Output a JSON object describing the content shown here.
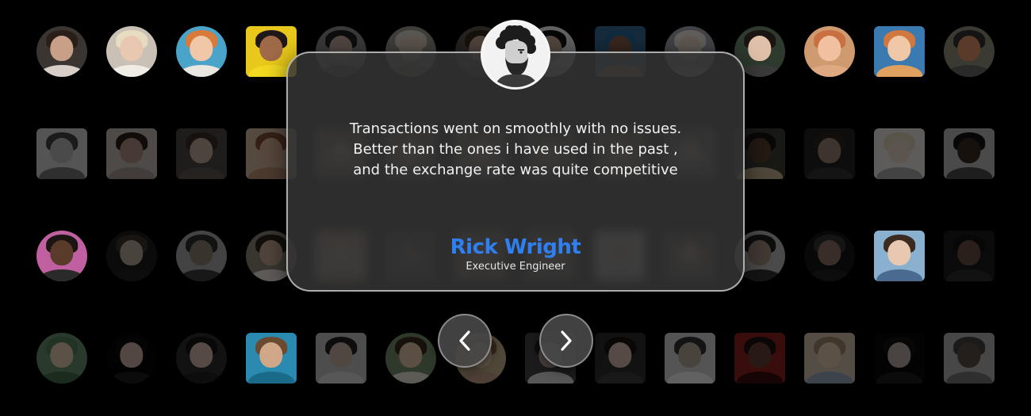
{
  "testimonial": {
    "quote_lines": [
      "Transactions went on smoothly with no issues.",
      "Better than the ones i have used in the past ,",
      "and the exchange rate was quite competitive"
    ],
    "name": "Rick Wright",
    "role": "Executive Engineer"
  },
  "nav": {
    "prev_icon": "chevron-left-icon",
    "next_icon": "chevron-right-icon"
  },
  "colors": {
    "accent": "#2f7ff0",
    "card_bg": "#343434",
    "background": "#000000"
  },
  "avatars": [
    {
      "shape": "circle",
      "bg": "#3a3530",
      "skin": "#c8a088",
      "hair": "#2a1f18",
      "cloth": "#d8d0c8",
      "tone": "normal"
    },
    {
      "shape": "circle",
      "bg": "#c9c1b5",
      "skin": "#e8c8b0",
      "hair": "#e8dcc0",
      "cloth": "#f0ece6",
      "tone": "normal"
    },
    {
      "shape": "circle",
      "bg": "#4aa3c8",
      "skin": "#f0c8a8",
      "hair": "#d87a3a",
      "cloth": "#eae6e0",
      "tone": "normal"
    },
    {
      "shape": "square",
      "bg": "#e8c81a",
      "skin": "#a06a48",
      "hair": "#201818",
      "cloth": "#f2d820",
      "tone": "normal"
    },
    {
      "shape": "circle",
      "bg": "#8a8a8a",
      "skin": "#c8a898",
      "hair": "#202020",
      "cloth": "#505050",
      "tone": "dim"
    },
    {
      "shape": "circle",
      "bg": "#9a9488",
      "skin": "#e0c8b0",
      "hair": "#d8d0c0",
      "cloth": "#807a70",
      "tone": "dim"
    },
    {
      "shape": "circle",
      "bg": "#5a5048",
      "skin": "#c8a088",
      "hair": "#3a2818",
      "cloth": "#404040",
      "tone": "dim"
    },
    {
      "shape": "circle",
      "bg": "#e8e8e8",
      "skin": "#c8a890",
      "hair": "#101010",
      "cloth": "#d0d0d0",
      "tone": "dim"
    },
    {
      "shape": "square",
      "bg": "#2a6a9a",
      "skin": "#8a5a40",
      "hair": "#1a6aa0",
      "cloth": "#b08040",
      "tone": "dim"
    },
    {
      "shape": "circle",
      "bg": "#9aa0a8",
      "skin": "#e8d0c0",
      "hair": "#e8e0d8",
      "cloth": "#c0c4c8",
      "tone": "dim"
    },
    {
      "shape": "circle",
      "bg": "#2e3a2e",
      "skin": "#e0c0a8",
      "hair": "#1a1412",
      "cloth": "#3a3a3a",
      "tone": "normal"
    },
    {
      "shape": "circle",
      "bg": "#d09a70",
      "skin": "#f0c0a0",
      "hair": "#c87040",
      "cloth": "#e0a880",
      "tone": "normal"
    },
    {
      "shape": "square",
      "bg": "#3a7ab0",
      "skin": "#f0c8a8",
      "hair": "#d07840",
      "cloth": "#e0a060",
      "tone": "normal"
    },
    {
      "shape": "circle",
      "bg": "#3a3a32",
      "skin": "#5a3a28",
      "hair": "#141414",
      "cloth": "#2a2a2a",
      "tone": "normal"
    },
    {
      "shape": "square",
      "bg": "#c8c8c8",
      "skin": "#b0b0b0",
      "hair": "#404040",
      "cloth": "#707070",
      "tone": "dim"
    },
    {
      "shape": "square",
      "bg": "#b8b0a8",
      "skin": "#b08878",
      "hair": "#2a1a14",
      "cloth": "#a0908a",
      "tone": "dim"
    },
    {
      "shape": "square",
      "bg": "#4a4440",
      "skin": "#c0a090",
      "hair": "#3a2a20",
      "cloth": "#5a5048",
      "tone": "dim"
    },
    {
      "shape": "square",
      "bg": "#d0b090",
      "skin": "#d8a888",
      "hair": "#8a4a28",
      "cloth": "#c08868",
      "tone": "dim"
    },
    {
      "shape": "square",
      "bg": "#8a7a6a",
      "skin": "#c8a088",
      "hair": "#3a2a20",
      "cloth": "#6a5a4a",
      "tone": "blurred"
    },
    {
      "shape": "square",
      "bg": "#7a7066",
      "skin": "#d0b098",
      "hair": "#4a3828",
      "cloth": "#5a5048",
      "tone": "blurred"
    },
    {
      "shape": "square",
      "bg": "#8a8076",
      "skin": "#c8a890",
      "hair": "#3a2a20",
      "cloth": "#6a6056",
      "tone": "blurred"
    },
    {
      "shape": "square",
      "bg": "#6a6058",
      "skin": "#b89880",
      "hair": "#2a1e18",
      "cloth": "#5a5048",
      "tone": "blurred"
    },
    {
      "shape": "square",
      "bg": "#7a7066",
      "skin": "#c8a088",
      "hair": "#3a2a20",
      "cloth": "#6a5a4a",
      "tone": "blurred"
    },
    {
      "shape": "square",
      "bg": "#6a6a6a",
      "skin": "#c0a898",
      "hair": "#2a2a2a",
      "cloth": "#505050",
      "tone": "blurred"
    },
    {
      "shape": "square",
      "bg": "#3a3830",
      "skin": "#5a3a28",
      "hair": "#1a1410",
      "cloth": "#c0a880",
      "tone": "dim"
    },
    {
      "shape": "square",
      "bg": "#202020",
      "skin": "#9a7a68",
      "hair": "#2a2018",
      "cloth": "#303030",
      "tone": "dim"
    },
    {
      "shape": "square",
      "bg": "#e0dcd8",
      "skin": "#e0c8b8",
      "hair": "#d8c8a8",
      "cloth": "#a0a0a0",
      "tone": "dim"
    },
    {
      "shape": "square",
      "bg": "#b0b0b0",
      "skin": "#3a2820",
      "hair": "#101010",
      "cloth": "#484848",
      "tone": "dim"
    },
    {
      "shape": "circle",
      "bg": "#c060a0",
      "skin": "#5a3a28",
      "hair": "#1a1412",
      "cloth": "#2a2a2a",
      "tone": "normal"
    },
    {
      "shape": "circle",
      "bg": "#1a1a1a",
      "skin": "#b0a090",
      "hair": "#3a3028",
      "cloth": "#202020",
      "tone": "dim"
    },
    {
      "shape": "circle",
      "bg": "#a0a0a0",
      "skin": "#8a7a6a",
      "hair": "#2a2a2a",
      "cloth": "#3a3a3a",
      "tone": "dim"
    },
    {
      "shape": "circle",
      "bg": "#8a8070",
      "skin": "#c8a088",
      "hair": "#2a2018",
      "cloth": "#e0d8d0",
      "tone": "dim"
    },
    {
      "shape": "square",
      "bg": "#d0b8a0",
      "skin": "#e0c0a0",
      "hair": "#b88060",
      "cloth": "#c0a080",
      "tone": "blurred"
    },
    {
      "shape": "square",
      "bg": "#3a3a3a",
      "skin": "#6a5a50",
      "hair": "#202020",
      "cloth": "#404040",
      "tone": "blurred"
    },
    {
      "shape": "square",
      "bg": "#8a7868",
      "skin": "#c8a888",
      "hair": "#4a3828",
      "cloth": "#6a5a4a",
      "tone": "blurred"
    },
    {
      "shape": "square",
      "bg": "#7a7066",
      "skin": "#c0a088",
      "hair": "#3a2a20",
      "cloth": "#5a5048",
      "tone": "blurred"
    },
    {
      "shape": "square",
      "bg": "#e0e0e0",
      "skin": "#e0c8b8",
      "hair": "#e8e0d8",
      "cloth": "#c0c0c0",
      "tone": "blurred"
    },
    {
      "shape": "square",
      "bg": "#5a5048",
      "skin": "#c09880",
      "hair": "#2a1e18",
      "cloth": "#504840",
      "tone": "blurred"
    },
    {
      "shape": "circle",
      "bg": "#b0b0b0",
      "skin": "#a08878",
      "hair": "#202020",
      "cloth": "#303030",
      "tone": "dim"
    },
    {
      "shape": "circle",
      "bg": "#141414",
      "skin": "#8a6a58",
      "hair": "#303030",
      "cloth": "#202020",
      "tone": "dim"
    },
    {
      "shape": "square",
      "bg": "#8ab0d0",
      "skin": "#e8c8b0",
      "hair": "#3a2a20",
      "cloth": "#4a6a90",
      "tone": "normal"
    },
    {
      "shape": "square",
      "bg": "#1a1a1a",
      "skin": "#6a4a38",
      "hair": "#101010",
      "cloth": "#2a2a2a",
      "tone": "dim"
    },
    {
      "shape": "circle",
      "bg": "#5a8a60",
      "skin": "#e0c0a0",
      "hair": "#4a7a50",
      "cloth": "#3a6a40",
      "tone": "dim"
    },
    {
      "shape": "circle",
      "bg": "#050505",
      "skin": "#c8a898",
      "hair": "#0a0a0a",
      "cloth": "#1a1a1a",
      "tone": "dim"
    },
    {
      "shape": "circle",
      "bg": "#2a2a2a",
      "skin": "#d0b0a0",
      "hair": "#141414",
      "cloth": "#202020",
      "tone": "dim"
    },
    {
      "shape": "square",
      "bg": "#2a8ab0",
      "skin": "#d0a888",
      "hair": "#6a4a30",
      "cloth": "#1a6a8a",
      "tone": "normal"
    },
    {
      "shape": "square",
      "bg": "#b8b8b8",
      "skin": "#c0a898",
      "hair": "#202020",
      "cloth": "#d0d0d0",
      "tone": "dim"
    },
    {
      "shape": "circle",
      "bg": "#6a8a60",
      "skin": "#e0b898",
      "hair": "#3a2818",
      "cloth": "#e0d8c8",
      "tone": "dim"
    },
    {
      "shape": "circle",
      "bg": "#c0a878",
      "skin": "#e0c0a0",
      "hair": "#8a5a38",
      "cloth": "#c09878",
      "tone": "dim"
    },
    {
      "shape": "square",
      "bg": "#404040",
      "skin": "#b09890",
      "hair": "#202020",
      "cloth": "#d0d0d0",
      "tone": "dim"
    },
    {
      "shape": "square",
      "bg": "#2a2a2a",
      "skin": "#d0b0a0",
      "hair": "#1a1210",
      "cloth": "#3a3a3a",
      "tone": "dim"
    },
    {
      "shape": "square",
      "bg": "#c8c8c8",
      "skin": "#b0a090",
      "hair": "#303030",
      "cloth": "#e8e8e8",
      "tone": "dim"
    },
    {
      "shape": "square",
      "bg": "#a01818",
      "skin": "#6a3a30",
      "hair": "#201010",
      "cloth": "#400a0a",
      "tone": "dim"
    },
    {
      "shape": "square",
      "bg": "#c8b8a0",
      "skin": "#e0c0a0",
      "hair": "#a08060",
      "cloth": "#8aa0b8",
      "tone": "dim"
    },
    {
      "shape": "square",
      "bg": "#080808",
      "skin": "#b0a098",
      "hair": "#101010",
      "cloth": "#1a1a1a",
      "tone": "dim"
    },
    {
      "shape": "square",
      "bg": "#a8a8a8",
      "skin": "#5a4a40",
      "hair": "#404040",
      "cloth": "#707070",
      "tone": "dim"
    }
  ]
}
